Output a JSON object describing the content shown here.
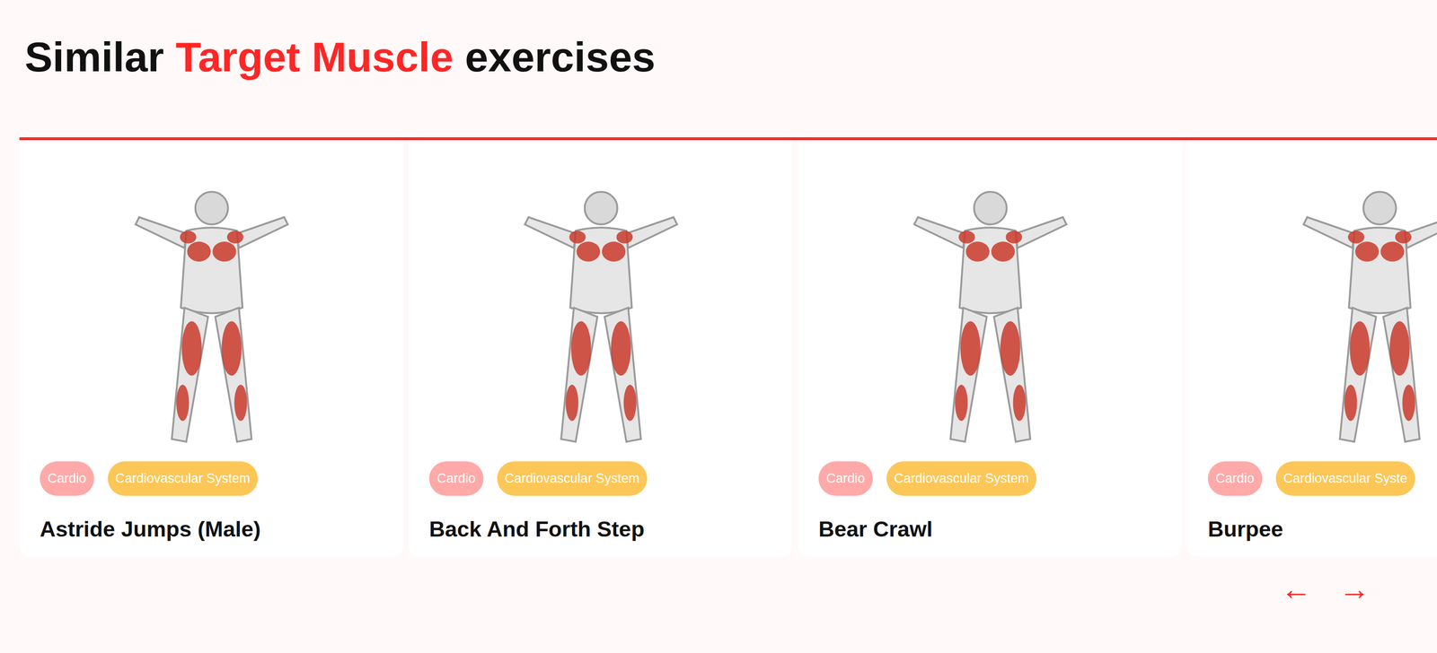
{
  "title": {
    "before": "Similar",
    "highlight": "Target Muscle",
    "after": "exercises"
  },
  "exercises": [
    {
      "name": "Astride Jumps (Male)",
      "tags": [
        {
          "label": "Cardio",
          "color": "#ffa9a9"
        },
        {
          "label": "Cardiovascular System",
          "color": "#fcc757"
        }
      ]
    },
    {
      "name": "Back And Forth Step",
      "tags": [
        {
          "label": "Cardio",
          "color": "#ffa9a9"
        },
        {
          "label": "Cardiovascular System",
          "color": "#fcc757"
        }
      ]
    },
    {
      "name": "Bear Crawl",
      "tags": [
        {
          "label": "Cardio",
          "color": "#ffa9a9"
        },
        {
          "label": "Cardiovascular System",
          "color": "#fcc757"
        }
      ]
    },
    {
      "name": "Burpee",
      "tags": [
        {
          "label": "Cardio",
          "color": "#ffa9a9"
        },
        {
          "label": "Cardiovascular Syste",
          "color": "#fcc757"
        }
      ]
    }
  ],
  "nav": {
    "prev": "←",
    "next": "→"
  }
}
